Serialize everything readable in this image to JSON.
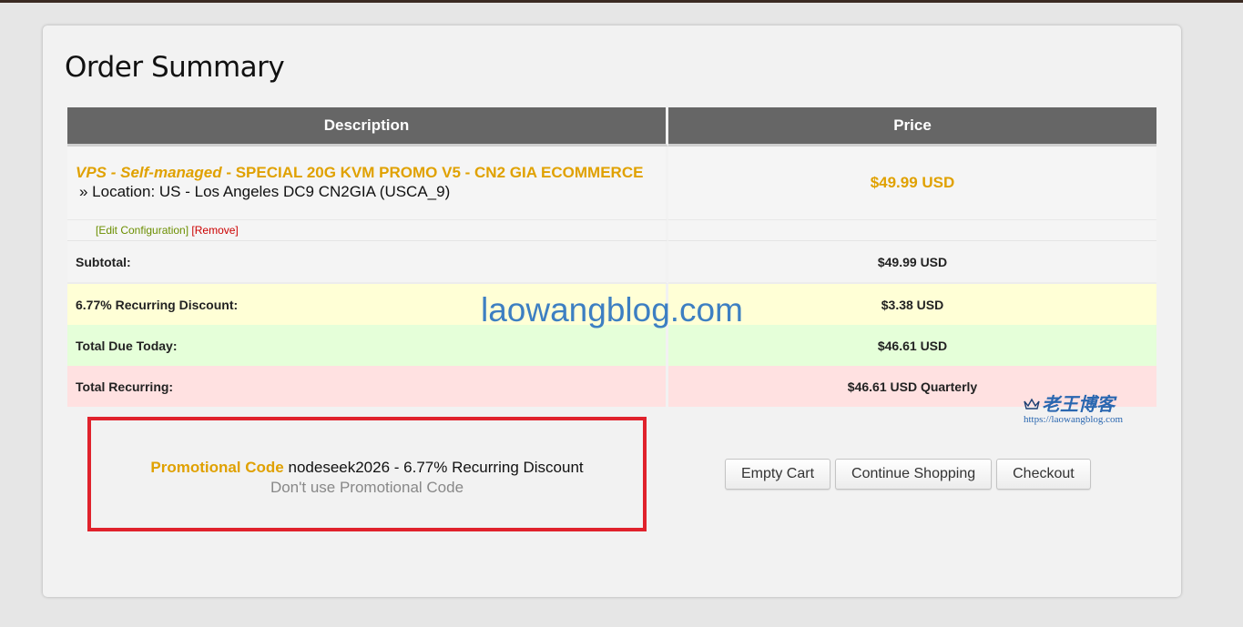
{
  "page": {
    "title": "Order Summary"
  },
  "cart": {
    "headers": {
      "description": "Description",
      "price": "Price"
    },
    "item": {
      "group": "VPS - Self-managed",
      "separator": " - ",
      "name": "SPECIAL 20G KVM PROMO V5 - CN2 GIA ECOMMERCE",
      "location": "» Location: US - Los Angeles DC9 CN2GIA (USCA_9)",
      "price": "$49.99 USD",
      "edit_label": "[Edit Configuration]",
      "remove_label": "[Remove]"
    },
    "totals": {
      "subtotal_label": "Subtotal:",
      "subtotal_value": "$49.99 USD",
      "discount_label": "6.77% Recurring Discount:",
      "discount_value": "$3.38 USD",
      "due_label": "Total Due Today:",
      "due_value": "$46.61 USD",
      "recurring_label": "Total Recurring:",
      "recurring_value": "$46.61 USD Quarterly"
    }
  },
  "promo": {
    "label": "Promotional Code",
    "code_text": "nodeseek2026 - 6.77% Recurring Discount",
    "remove_label": "Don't use Promotional Code"
  },
  "actions": {
    "empty_cart": "Empty Cart",
    "continue_shopping": "Continue Shopping",
    "checkout": "Checkout"
  },
  "watermark": {
    "text": "laowangblog.com",
    "logo_cn": "老王博客",
    "logo_url": "https://laowangblog.com"
  },
  "colors": {
    "header_bg": "#666666",
    "accent_orange": "#e0a100",
    "promo_border": "#e0222c",
    "discount_row": "#ffffd6",
    "due_row": "#e5ffd9",
    "recurring_row": "#ffe1e1",
    "watermark_blue": "#3d7fc2"
  },
  "icons": {
    "logo": "crown-icon"
  }
}
